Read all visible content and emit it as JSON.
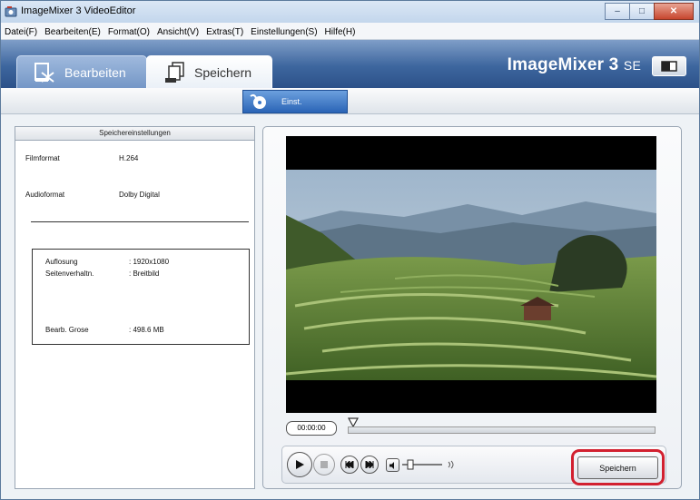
{
  "window": {
    "title": "ImageMixer 3 VideoEditor"
  },
  "menu": [
    "Datei(F)",
    "Bearbeiten(E)",
    "Format(O)",
    "Ansicht(V)",
    "Extras(T)",
    "Einstellungen(S)",
    "Hilfe(H)"
  ],
  "tabs": {
    "edit": "Bearbeiten",
    "save": "Speichern"
  },
  "brand": {
    "name": "ImageMixer 3",
    "edition": "SE"
  },
  "subtoolbar": {
    "settings_label": "Einst."
  },
  "settings": {
    "header": "Speichereinstellungen",
    "film_format_label": "Filmformat",
    "film_format_value": "H.264",
    "audio_format_label": "Audioformat",
    "audio_format_value": "Dolby Digital",
    "resolution_label": "Auflosung",
    "resolution_value": ": 1920x1080",
    "aspect_label": "Seitenverhaltn.",
    "aspect_value": ": Breitbild",
    "size_label": "Bearb. Grose",
    "size_value": ": 498.6 MB"
  },
  "player": {
    "timecode": "00:00:00",
    "save_button": "Speichern"
  },
  "colors": {
    "accent": "#2a64b6",
    "highlight": "#d2202f",
    "header": "#3d669e"
  }
}
